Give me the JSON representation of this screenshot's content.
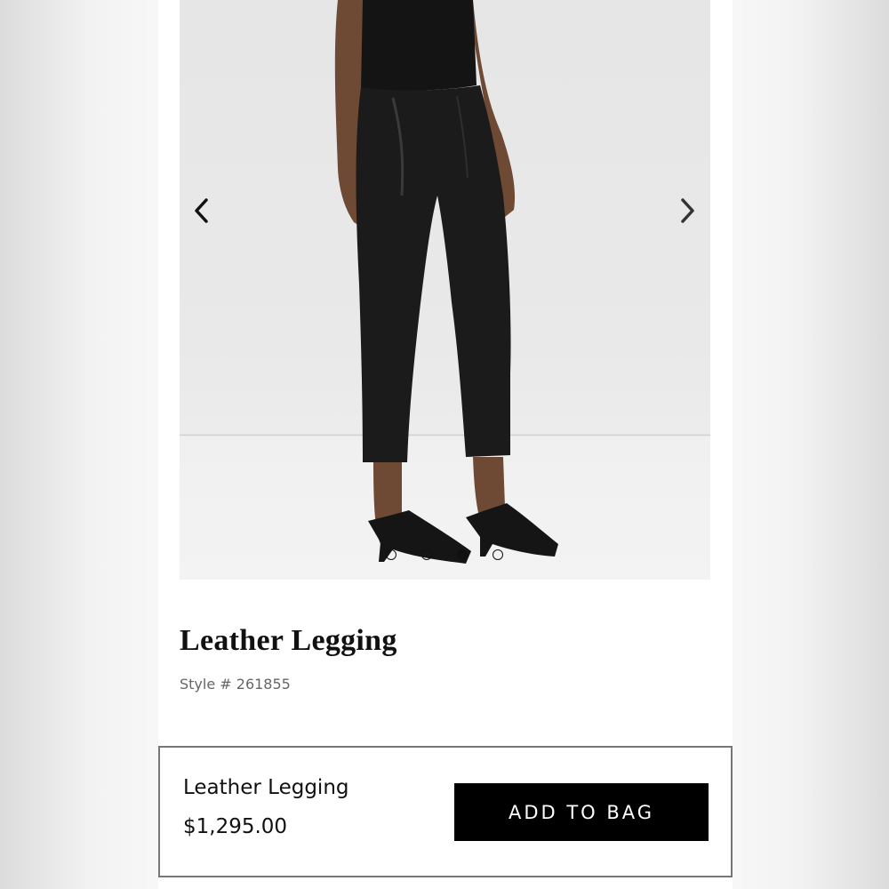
{
  "gallery": {
    "image_alt": "Model wearing black leather legging with black heeled sandals",
    "prev_icon": "chevron-left-icon",
    "next_icon": "chevron-right-icon",
    "dot_count": 4,
    "active_dot": 2
  },
  "product": {
    "title": "Leather Legging",
    "style_number": "Style # 261855"
  },
  "sticky_bar": {
    "name": "Leather Legging",
    "price": "$1,295.00",
    "add_to_bag_label": "ADD TO BAG"
  },
  "colors": {
    "button_bg": "#000000",
    "button_text": "#ffffff",
    "text": "#111111",
    "muted_text": "#666666"
  }
}
